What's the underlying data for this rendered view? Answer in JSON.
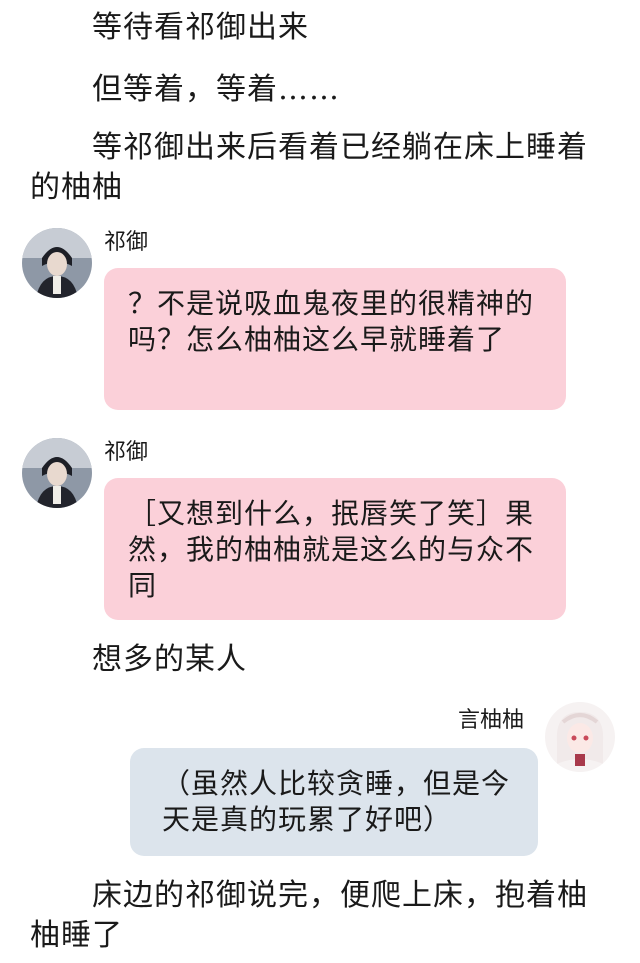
{
  "narration": {
    "line1": "等待看祁御出来",
    "line2": "但等着，等着……",
    "line3": "等祁御出来后看着已经躺在床上睡着的柚柚",
    "line4": "想多的某人",
    "line5": "床边的祁御说完，便爬上床，抱着柚柚睡了"
  },
  "messages": [
    {
      "speaker": "祁御",
      "text": "？不是说吸血鬼夜里的很精神的吗？怎么柚柚这么早就睡着了",
      "bubble_color": "#fbd0d9"
    },
    {
      "speaker": "祁御",
      "text": "［又想到什么，抿唇笑了笑］果然，我的柚柚就是这么的与众不同",
      "bubble_color": "#fbd0d9"
    },
    {
      "speaker": "言柚柚",
      "text": "（虽然人比较贪睡，但是今天是真的玩累了好吧）",
      "bubble_color": "#dce4ec"
    }
  ],
  "avatars": {
    "qiyu": "dark-haired-man-portrait",
    "yanyouyou": "white-haired-girl-portrait"
  }
}
